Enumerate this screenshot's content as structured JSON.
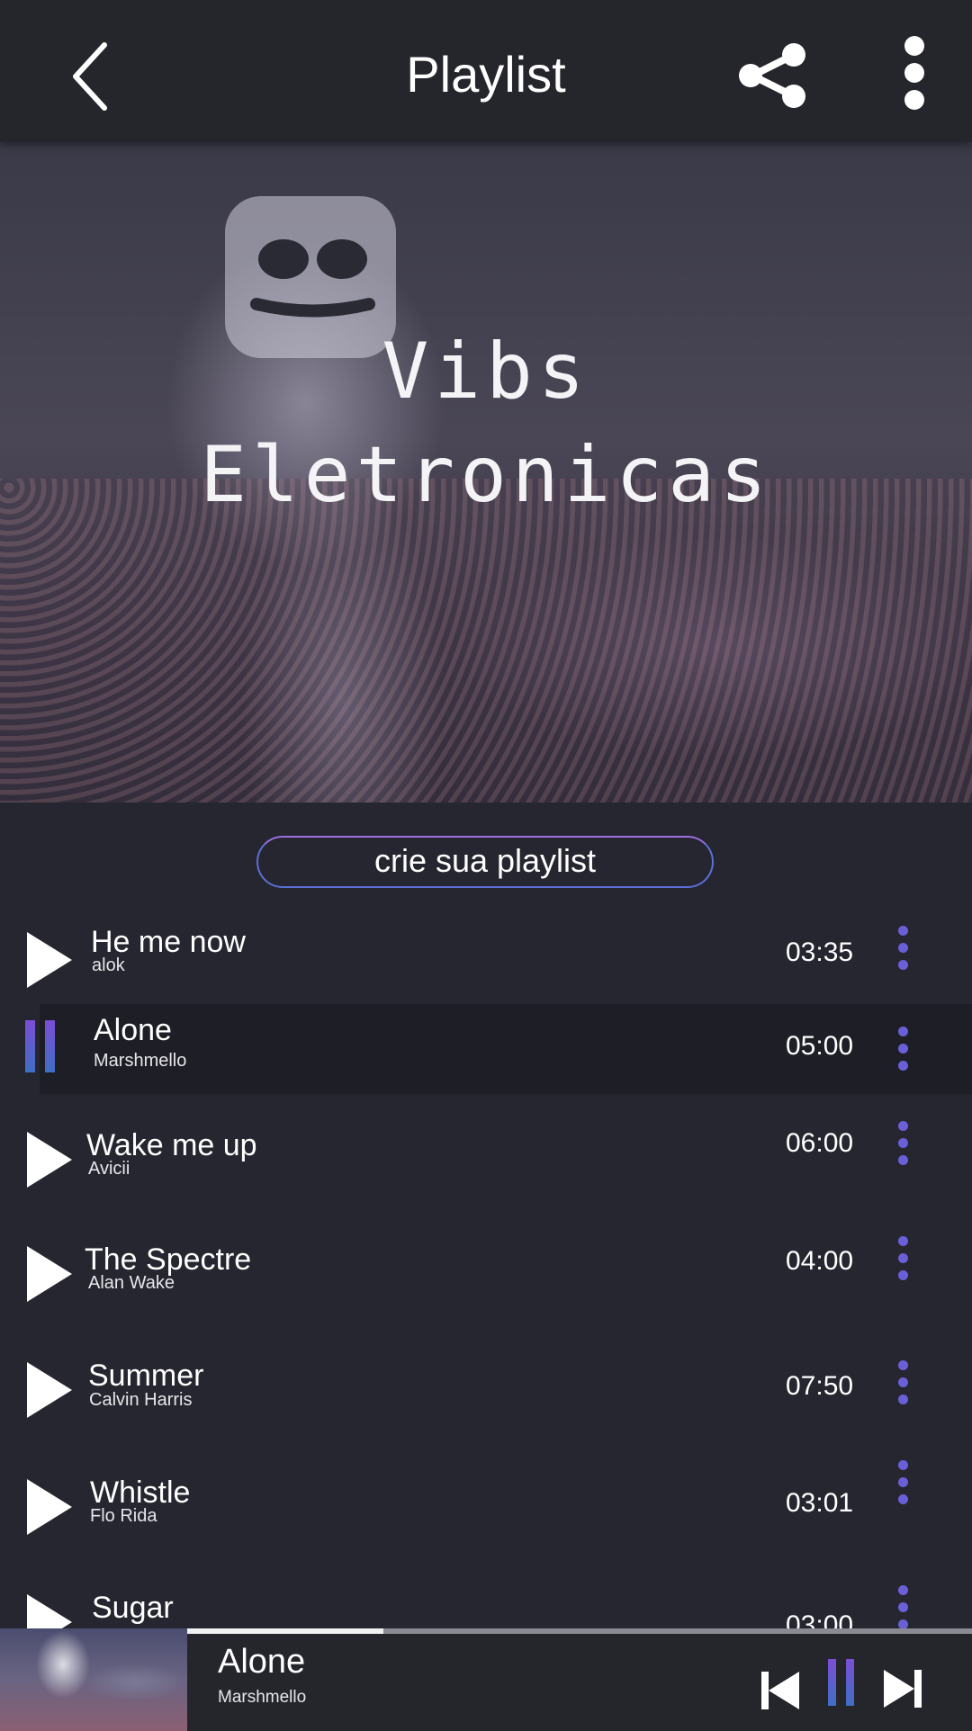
{
  "header": {
    "title": "Playlist"
  },
  "hero": {
    "line1": "Vibs",
    "line2": "Eletronicas"
  },
  "create_button": {
    "label": "crie sua playlist"
  },
  "tracks": [
    {
      "title": "He me now",
      "artist": "alok",
      "duration": "03:35",
      "state": "play"
    },
    {
      "title": "Alone",
      "artist": "Marshmello",
      "duration": "05:00",
      "state": "playing"
    },
    {
      "title": "Wake me up",
      "artist": "Avicii",
      "duration": "06:00",
      "state": "play"
    },
    {
      "title": "The Spectre",
      "artist": "Alan Wake",
      "duration": "04:00",
      "state": "play"
    },
    {
      "title": "Summer",
      "artist": "Calvin Harris",
      "duration": "07:50",
      "state": "play"
    },
    {
      "title": "Whistle",
      "artist": "Flo Rida",
      "duration": "03:01",
      "state": "play"
    },
    {
      "title": "Sugar",
      "artist": "",
      "duration": "03:00",
      "state": "play"
    }
  ],
  "now_playing": {
    "title": "Alone",
    "artist": "Marshmello",
    "progress": 0.25
  },
  "colors": {
    "accent": "#6b5fd8",
    "pause_gradient_top": "#7b4ed6",
    "pause_gradient_bottom": "#3f6fc4",
    "background": "#262630"
  }
}
